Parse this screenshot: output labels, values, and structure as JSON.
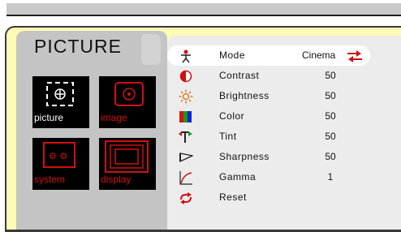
{
  "title": "PICTURE",
  "tiles": [
    {
      "label": "picture",
      "icon": "picture-icon",
      "selected": true
    },
    {
      "label": "image",
      "icon": "image-icon",
      "selected": false
    },
    {
      "label": "system",
      "icon": "system-icon",
      "selected": false
    },
    {
      "label": "display",
      "icon": "display-icon",
      "selected": false
    }
  ],
  "menu": [
    {
      "label": "Mode",
      "value": "Cinema",
      "icon": "person-icon"
    },
    {
      "label": "Contrast",
      "value": "50",
      "icon": "contrast-icon"
    },
    {
      "label": "Brightness",
      "value": "50",
      "icon": "brightness-icon"
    },
    {
      "label": "Color",
      "value": "50",
      "icon": "color-icon"
    },
    {
      "label": "Tint",
      "value": "50",
      "icon": "tint-icon"
    },
    {
      "label": "Sharpness",
      "value": "50",
      "icon": "sharpness-icon"
    },
    {
      "label": "Gamma",
      "value": "1",
      "icon": "gamma-icon"
    },
    {
      "label": "Reset",
      "value": "",
      "icon": "reset-icon"
    }
  ],
  "colors": {
    "frame": "#fdfcb6",
    "panel": "#c4c4c4",
    "menu": "#ececec",
    "accent": "#d01010"
  }
}
